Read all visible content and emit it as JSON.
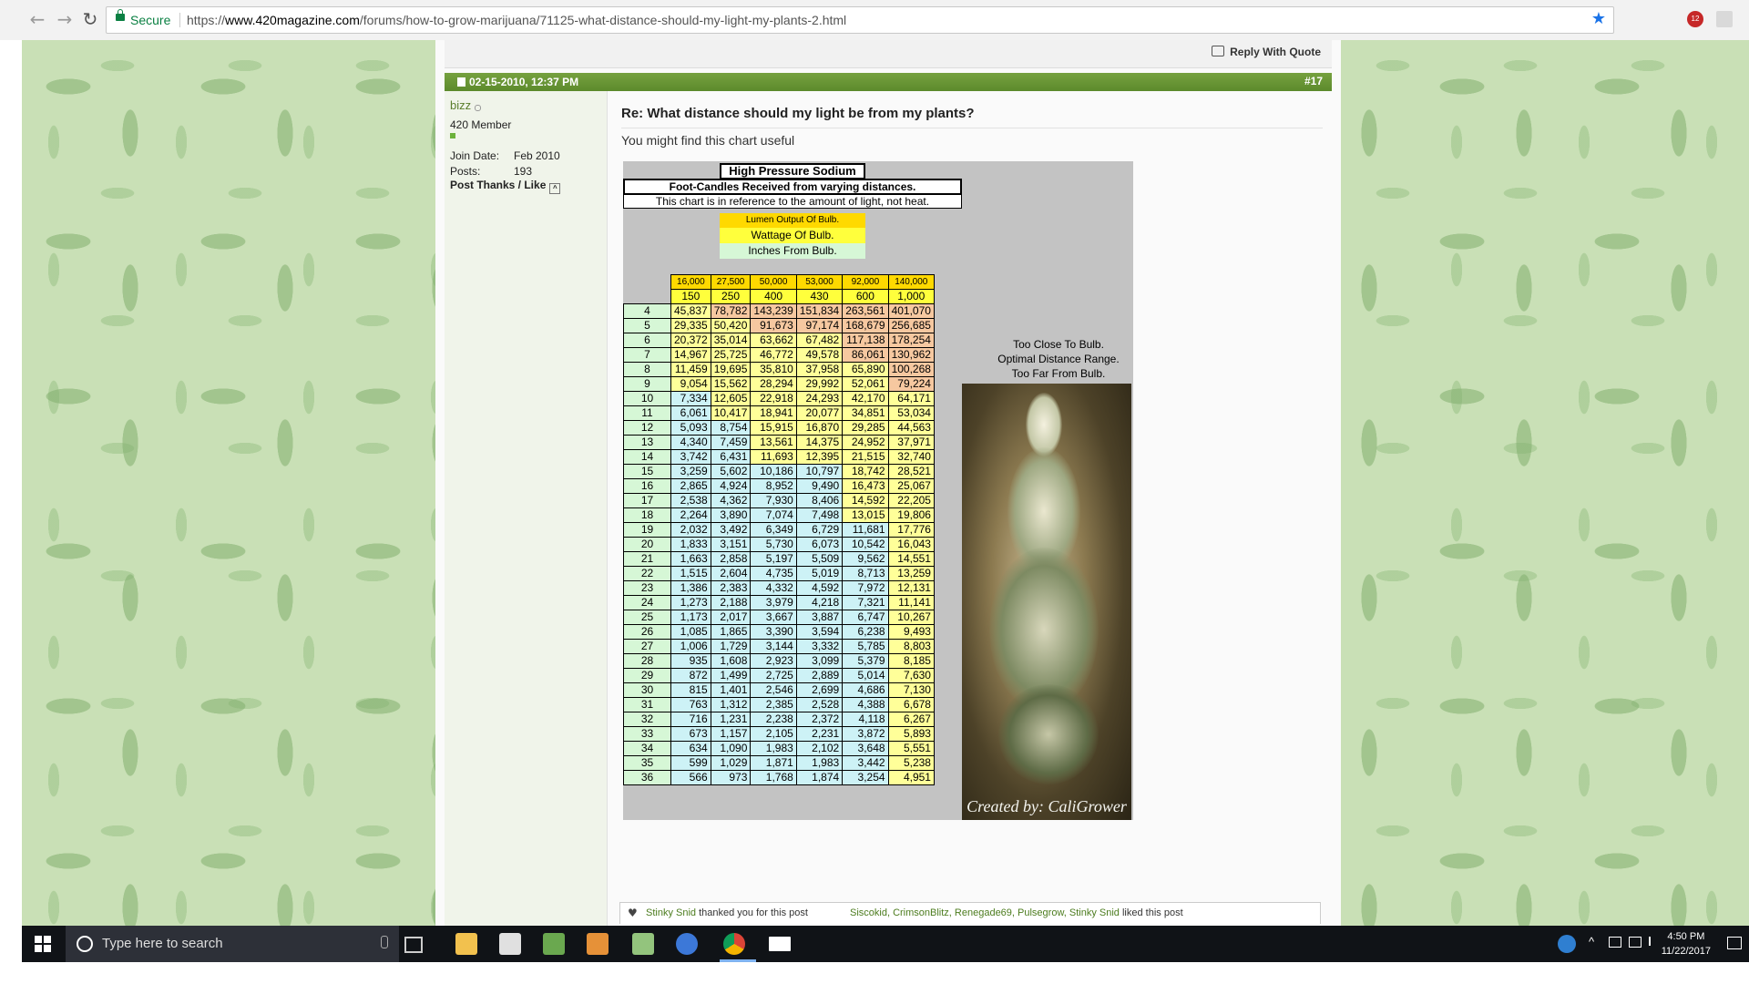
{
  "browser": {
    "secure_label": "Secure",
    "url_scheme": "https://",
    "url_host": "www.420magazine.com",
    "url_path": "/forums/how-to-grow-marijuana/71125-what-distance-should-my-light-my-plants-2.html",
    "ext_badge": "12"
  },
  "toolbar": {
    "reply_quote": "Reply With Quote"
  },
  "post": {
    "datetime": "02-15-2010, 12:37 PM",
    "number": "#17",
    "title": "Re: What distance should my light be from my plants?",
    "body": "You might find this chart useful"
  },
  "user": {
    "name": "bizz",
    "title": "420 Member",
    "join_label": "Join Date:",
    "join_value": "Feb 2010",
    "posts_label": "Posts:",
    "posts_value": "193",
    "thanks_like": "Post Thanks / Like"
  },
  "chart_image": {
    "title": "High Pressure Sodium",
    "subtitle": "Foot-Candles Received from varying distances.",
    "note": "This chart is in reference to the amount of light, not heat.",
    "key_lumen": "Lumen Output Of Bulb.",
    "key_watt": "Wattage Of Bulb.",
    "key_inches": "Inches From Bulb.",
    "legend_close": "Too Close To Bulb.",
    "legend_optimal": "Optimal Distance Range.",
    "legend_far": "Too Far From Bulb.",
    "credit": "Created by: CaliGrower",
    "colors": {
      "close": "#f6c8a0",
      "optimal": "#ffff99",
      "far": "#cdf2f6",
      "inches": "#d6f7d6",
      "lumen": "#ffd900",
      "watt": "#ffff3c"
    },
    "lumens": [
      "16,000",
      "27,500",
      "50,000",
      "53,000",
      "92,000",
      "140,000"
    ],
    "watts": [
      "150",
      "250",
      "400",
      "430",
      "600",
      "1,000"
    ],
    "rows": [
      [
        "4",
        "45,837",
        "78,782",
        "143,239",
        "151,834",
        "263,561",
        "401,070"
      ],
      [
        "5",
        "29,335",
        "50,420",
        "91,673",
        "97,174",
        "168,679",
        "256,685"
      ],
      [
        "6",
        "20,372",
        "35,014",
        "63,662",
        "67,482",
        "117,138",
        "178,254"
      ],
      [
        "7",
        "14,967",
        "25,725",
        "46,772",
        "49,578",
        "86,061",
        "130,962"
      ],
      [
        "8",
        "11,459",
        "19,695",
        "35,810",
        "37,958",
        "65,890",
        "100,268"
      ],
      [
        "9",
        "9,054",
        "15,562",
        "28,294",
        "29,992",
        "52,061",
        "79,224"
      ],
      [
        "10",
        "7,334",
        "12,605",
        "22,918",
        "24,293",
        "42,170",
        "64,171"
      ],
      [
        "11",
        "6,061",
        "10,417",
        "18,941",
        "20,077",
        "34,851",
        "53,034"
      ],
      [
        "12",
        "5,093",
        "8,754",
        "15,915",
        "16,870",
        "29,285",
        "44,563"
      ],
      [
        "13",
        "4,340",
        "7,459",
        "13,561",
        "14,375",
        "24,952",
        "37,971"
      ],
      [
        "14",
        "3,742",
        "6,431",
        "11,693",
        "12,395",
        "21,515",
        "32,740"
      ],
      [
        "15",
        "3,259",
        "5,602",
        "10,186",
        "10,797",
        "18,742",
        "28,521"
      ],
      [
        "16",
        "2,865",
        "4,924",
        "8,952",
        "9,490",
        "16,473",
        "25,067"
      ],
      [
        "17",
        "2,538",
        "4,362",
        "7,930",
        "8,406",
        "14,592",
        "22,205"
      ],
      [
        "18",
        "2,264",
        "3,890",
        "7,074",
        "7,498",
        "13,015",
        "19,806"
      ],
      [
        "19",
        "2,032",
        "3,492",
        "6,349",
        "6,729",
        "11,681",
        "17,776"
      ],
      [
        "20",
        "1,833",
        "3,151",
        "5,730",
        "6,073",
        "10,542",
        "16,043"
      ],
      [
        "21",
        "1,663",
        "2,858",
        "5,197",
        "5,509",
        "9,562",
        "14,551"
      ],
      [
        "22",
        "1,515",
        "2,604",
        "4,735",
        "5,019",
        "8,713",
        "13,259"
      ],
      [
        "23",
        "1,386",
        "2,383",
        "4,332",
        "4,592",
        "7,972",
        "12,131"
      ],
      [
        "24",
        "1,273",
        "2,188",
        "3,979",
        "4,218",
        "7,321",
        "11,141"
      ],
      [
        "25",
        "1,173",
        "2,017",
        "3,667",
        "3,887",
        "6,747",
        "10,267"
      ],
      [
        "26",
        "1,085",
        "1,865",
        "3,390",
        "3,594",
        "6,238",
        "9,493"
      ],
      [
        "27",
        "1,006",
        "1,729",
        "3,144",
        "3,332",
        "5,785",
        "8,803"
      ],
      [
        "28",
        "935",
        "1,608",
        "2,923",
        "3,099",
        "5,379",
        "8,185"
      ],
      [
        "29",
        "872",
        "1,499",
        "2,725",
        "2,889",
        "5,014",
        "7,630"
      ],
      [
        "30",
        "815",
        "1,401",
        "2,546",
        "2,699",
        "4,686",
        "7,130"
      ],
      [
        "31",
        "763",
        "1,312",
        "2,385",
        "2,528",
        "4,388",
        "6,678"
      ],
      [
        "32",
        "716",
        "1,231",
        "2,238",
        "2,372",
        "4,118",
        "6,267"
      ],
      [
        "33",
        "673",
        "1,157",
        "2,105",
        "2,231",
        "3,872",
        "5,893"
      ],
      [
        "34",
        "634",
        "1,090",
        "1,983",
        "2,102",
        "3,648",
        "5,551"
      ],
      [
        "35",
        "599",
        "1,029",
        "1,871",
        "1,983",
        "3,442",
        "5,238"
      ],
      [
        "36",
        "566",
        "973",
        "1,768",
        "1,874",
        "3,254",
        "4,951"
      ]
    ],
    "zones": [
      [
        "o",
        "c",
        "c",
        "c",
        "c",
        "c"
      ],
      [
        "o",
        "o",
        "c",
        "c",
        "c",
        "c"
      ],
      [
        "o",
        "o",
        "o",
        "o",
        "c",
        "c"
      ],
      [
        "o",
        "o",
        "o",
        "o",
        "c",
        "c"
      ],
      [
        "o",
        "o",
        "o",
        "o",
        "o",
        "c"
      ],
      [
        "o",
        "o",
        "o",
        "o",
        "o",
        "c"
      ],
      [
        "f",
        "o",
        "o",
        "o",
        "o",
        "o"
      ],
      [
        "f",
        "o",
        "o",
        "o",
        "o",
        "o"
      ],
      [
        "f",
        "f",
        "o",
        "o",
        "o",
        "o"
      ],
      [
        "f",
        "f",
        "o",
        "o",
        "o",
        "o"
      ],
      [
        "f",
        "f",
        "o",
        "o",
        "o",
        "o"
      ],
      [
        "f",
        "f",
        "f",
        "f",
        "o",
        "o"
      ],
      [
        "f",
        "f",
        "f",
        "f",
        "o",
        "o"
      ],
      [
        "f",
        "f",
        "f",
        "f",
        "o",
        "o"
      ],
      [
        "f",
        "f",
        "f",
        "f",
        "o",
        "o"
      ],
      [
        "f",
        "f",
        "f",
        "f",
        "f",
        "o"
      ],
      [
        "f",
        "f",
        "f",
        "f",
        "f",
        "o"
      ],
      [
        "f",
        "f",
        "f",
        "f",
        "f",
        "o"
      ],
      [
        "f",
        "f",
        "f",
        "f",
        "f",
        "o"
      ],
      [
        "f",
        "f",
        "f",
        "f",
        "f",
        "o"
      ],
      [
        "f",
        "f",
        "f",
        "f",
        "f",
        "o"
      ],
      [
        "f",
        "f",
        "f",
        "f",
        "f",
        "o"
      ],
      [
        "f",
        "f",
        "f",
        "f",
        "f",
        "o"
      ],
      [
        "f",
        "f",
        "f",
        "f",
        "f",
        "o"
      ],
      [
        "f",
        "f",
        "f",
        "f",
        "f",
        "o"
      ],
      [
        "f",
        "f",
        "f",
        "f",
        "f",
        "o"
      ],
      [
        "f",
        "f",
        "f",
        "f",
        "f",
        "o"
      ],
      [
        "f",
        "f",
        "f",
        "f",
        "f",
        "o"
      ],
      [
        "f",
        "f",
        "f",
        "f",
        "f",
        "o"
      ],
      [
        "f",
        "f",
        "f",
        "f",
        "f",
        "o"
      ],
      [
        "f",
        "f",
        "f",
        "f",
        "f",
        "o"
      ],
      [
        "f",
        "f",
        "f",
        "f",
        "f",
        "o"
      ],
      [
        "f",
        "f",
        "f",
        "f",
        "f",
        "o"
      ]
    ]
  },
  "thanks": {
    "thanked_user": "Stinky Snid",
    "thanked_text": "thanked you for this post",
    "liked_users": "Siscokid, CrimsonBlitz, Renegade69, Pulsegrow, Stinky Snid",
    "liked_text": "liked this post"
  },
  "taskbar": {
    "search_placeholder": "Type here to search",
    "time": "4:50 PM",
    "date": "11/22/2017"
  }
}
